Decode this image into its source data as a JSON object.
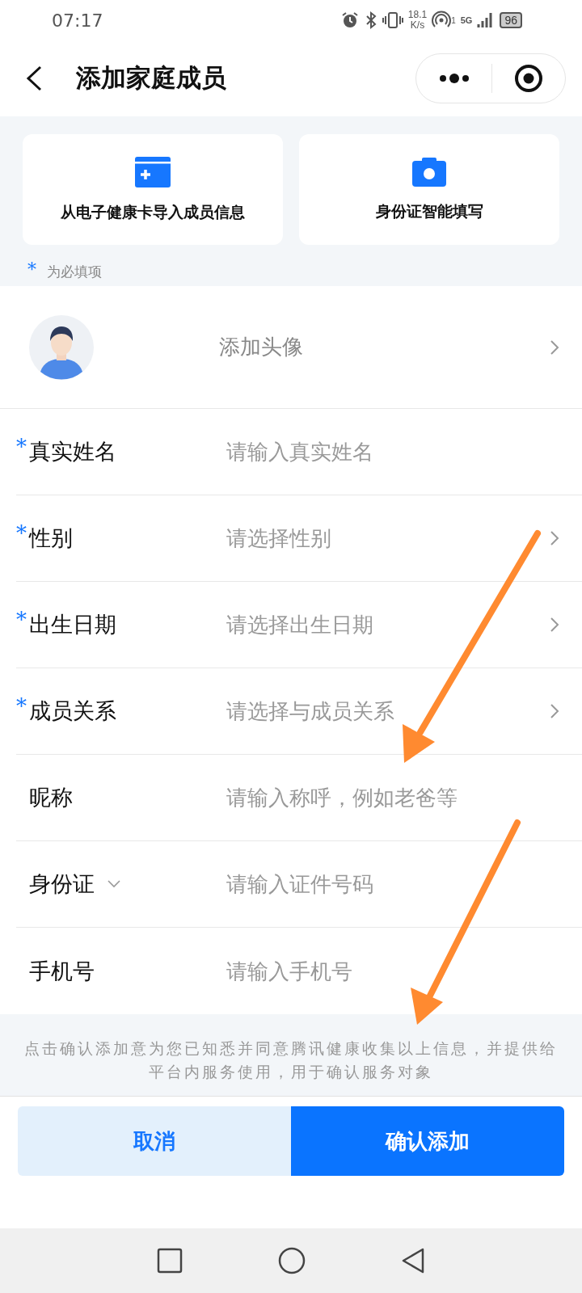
{
  "status_bar": {
    "time": "07:17",
    "speed": "18.1",
    "speed_unit": "K/s",
    "hotspot_count": "1",
    "network": "5G",
    "battery": "96"
  },
  "header": {
    "title": "添加家庭成员"
  },
  "import_cards": [
    {
      "kind": "health-card",
      "label": "从电子健康卡导入成员信息"
    },
    {
      "kind": "camera",
      "label": "身份证智能填写"
    }
  ],
  "required_note": {
    "mark": "*",
    "text": "为必填项"
  },
  "avatar_row": {
    "label": "添加头像"
  },
  "fields": [
    {
      "mark": "*",
      "label": "真实姓名",
      "kind": "input",
      "placeholder": "请输入真实姓名"
    },
    {
      "mark": "*",
      "label": "性别",
      "kind": "select",
      "placeholder": "请选择性别"
    },
    {
      "mark": "*",
      "label": "出生日期",
      "kind": "select",
      "placeholder": "请选择出生日期"
    },
    {
      "mark": "*",
      "label": "成员关系",
      "kind": "select",
      "placeholder": "请选择与成员关系"
    },
    {
      "label": "昵称",
      "kind": "input",
      "placeholder": "请输入称呼，例如老爸等"
    },
    {
      "label": "身份证",
      "kind": "id-type",
      "placeholder": "请输入证件号码"
    },
    {
      "label": "手机号",
      "kind": "input",
      "placeholder": "请输入手机号"
    }
  ],
  "notice": "点击确认添加意为您已知悉并同意腾讯健康收集以上信息，并提供给平台内服务使用，用于确认服务对象",
  "buttons": {
    "cancel": "取消",
    "confirm": "确认添加"
  }
}
